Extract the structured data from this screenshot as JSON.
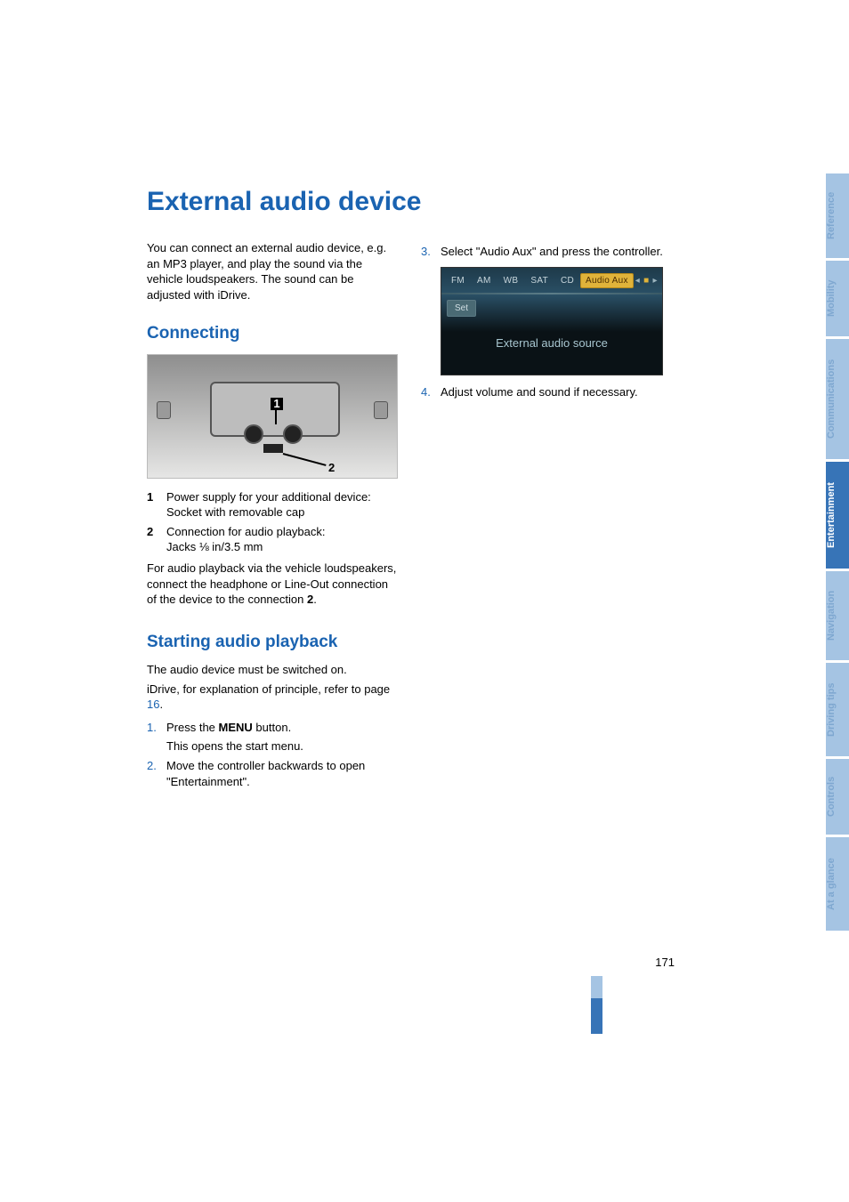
{
  "title": "External audio device",
  "intro": "You can connect an external audio device, e.g. an MP3 player, and play the sound via the vehicle loudspeakers. The sound can be adjusted with iDrive.",
  "sections": {
    "connecting": {
      "heading": "Connecting",
      "fig_labels": {
        "l1": "1",
        "l2": "2"
      },
      "legend": [
        {
          "num": "1",
          "line1": "Power supply for your additional device:",
          "line2": "Socket with removable cap"
        },
        {
          "num": "2",
          "line1": "Connection for audio playback:",
          "line2": "Jacks ⅛ in/3.5 mm"
        }
      ],
      "note_pre": "For audio playback via the vehicle loudspeakers, connect the headphone or Line-Out connection of the device to the connection ",
      "note_bold": "2",
      "note_post": "."
    },
    "starting": {
      "heading": "Starting audio playback",
      "p1": "The audio device must be switched on.",
      "p2_pre": "iDrive, for explanation of principle, refer to page ",
      "p2_link": "16",
      "p2_post": ".",
      "steps_left": [
        {
          "num": "1.",
          "pre": "Press the ",
          "bold": "MENU",
          "post": " button.",
          "sub": "This opens the start menu."
        },
        {
          "num": "2.",
          "pre": "Move the controller backwards to open \"Entertainment\".",
          "bold": "",
          "post": "",
          "sub": ""
        }
      ],
      "steps_right": [
        {
          "num": "3.",
          "text": "Select \"Audio Aux\" and press the controller."
        },
        {
          "num": "4.",
          "text": "Adjust volume and sound if necessary."
        }
      ]
    }
  },
  "screenshot": {
    "tabs": {
      "fm": "FM",
      "am": "AM",
      "wb": "WB",
      "sat": "SAT",
      "cd": "CD",
      "aux": "Audio Aux"
    },
    "set": "Set",
    "main": "External audio source"
  },
  "side_tabs": {
    "reference": "Reference",
    "mobility": "Mobility",
    "communications": "Communications",
    "entertainment": "Entertainment",
    "navigation": "Navigation",
    "driving": "Driving tips",
    "controls": "Controls",
    "glance": "At a glance"
  },
  "page_number": "171"
}
